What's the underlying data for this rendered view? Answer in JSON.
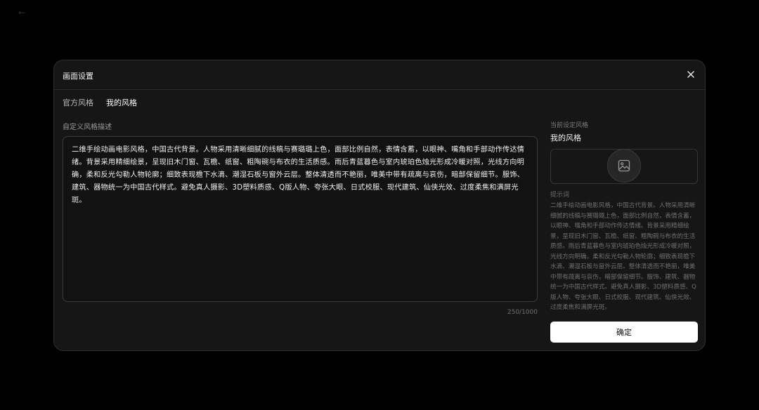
{
  "modal": {
    "title": "画面设置",
    "close_icon": "close-icon",
    "tabs": [
      {
        "label": "官方风格",
        "active": false
      },
      {
        "label": "我的风格",
        "active": true
      }
    ],
    "field_label": "自定义风格描述",
    "description": "二维手绘动画电影风格，中国古代背景。人物采用清晰细腻的线稿与赛璐璐上色，面部比例自然，表情含蓄，以眼神、嘴角和手部动作传达情绪。背景采用精细绘景，呈现旧木门窗、瓦檐、纸窗、粗陶碗与布衣的生活质感。雨后青蓝暮色与室内琥珀色烛光形成冷暖对照，光线方向明确，柔和反光勾勒人物轮廓；细致表现檐下水滴、潮湿石板与窗外云层。整体清透而不艳丽，唯美中带有疏离与哀伤，暗部保留细节。服饰、建筑、器物统一为中国古代样式。避免真人摄影、3D塑料质感、Q版人物、夸张大眼、日式校服、现代建筑、仙侠光效、过度柔焦和满屏光斑。",
    "counter": "250/1000",
    "side": {
      "current_label": "当前设定风格",
      "current_name": "我的风格",
      "preview_icon": "image-icon",
      "hint_label": "提示词",
      "hint_text": "二维手绘动画电影风格，中国古代背景。人物采用清晰细腻的线稿与赛璐璐上色，面部比例自然，表情含蓄，以眼神、嘴角和手部动作传达情绪。背景采用精细绘景，呈现旧木门窗、瓦檐、纸窗、粗陶碗与布衣的生活质感。雨后青蓝暮色与室内琥珀色烛光形成冷暖对照，光线方向明确，柔和反光勾勒人物轮廓；细致表现檐下水滴、潮湿石板与窗外云层。整体清透而不艳丽，唯美中带有疏离与哀伤，暗部保留细节。服饰、建筑、器物统一为中国古代样式。避免真人摄影、3D塑料质感、Q版人物、夸张大眼、日式校服、现代建筑、仙侠光效、过度柔焦和满屏光斑。",
      "confirm_label": "确定"
    }
  },
  "colors": {
    "background": "#000000",
    "modal_bg": "#161616",
    "confirm_bg": "#ffffff"
  }
}
